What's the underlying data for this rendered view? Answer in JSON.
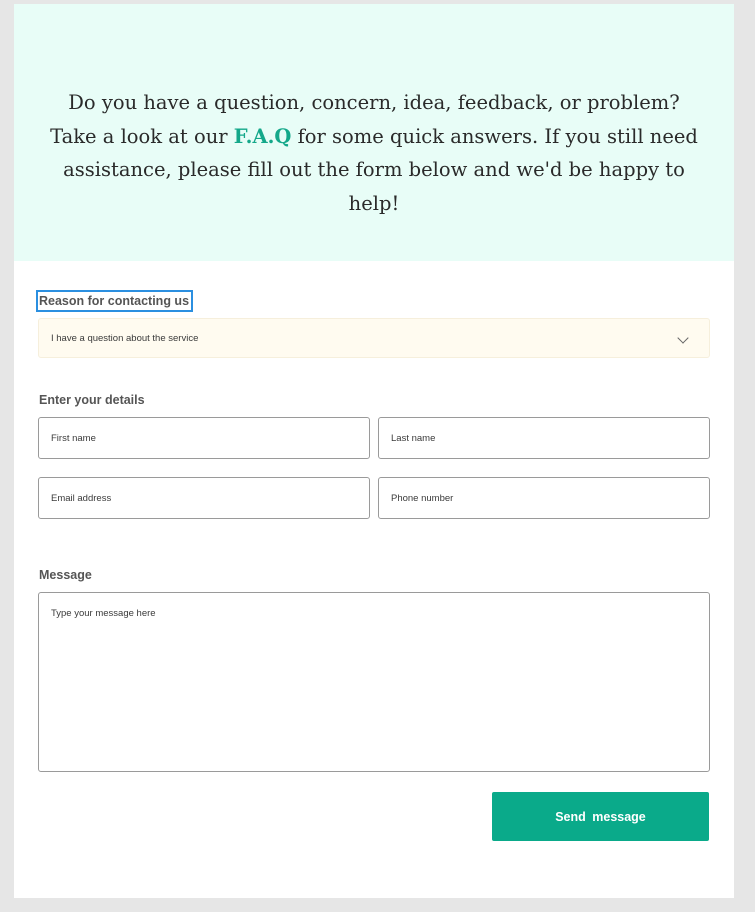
{
  "hero": {
    "text_before": "Do you have a question, concern, idea, feedback, or problem? Take a look at our ",
    "faq_link": "F.A.Q",
    "text_after": " for some quick answers. If you still need assistance, please fill out the form below and we'd be happy to help!"
  },
  "reason": {
    "label": "Reason for contacting us",
    "selected": "I have a question about the service"
  },
  "details": {
    "label": "Enter your details",
    "first_name_placeholder": "First name",
    "last_name_placeholder": "Last name",
    "email_placeholder": "Email address",
    "phone_placeholder": "Phone number"
  },
  "message": {
    "label": "Message",
    "placeholder": "Type your message here"
  },
  "send_label": "Send message",
  "colors": {
    "accent": "#0aaa8a",
    "hero_bg": "#e8fdf7",
    "select_bg": "#fffbf0"
  }
}
